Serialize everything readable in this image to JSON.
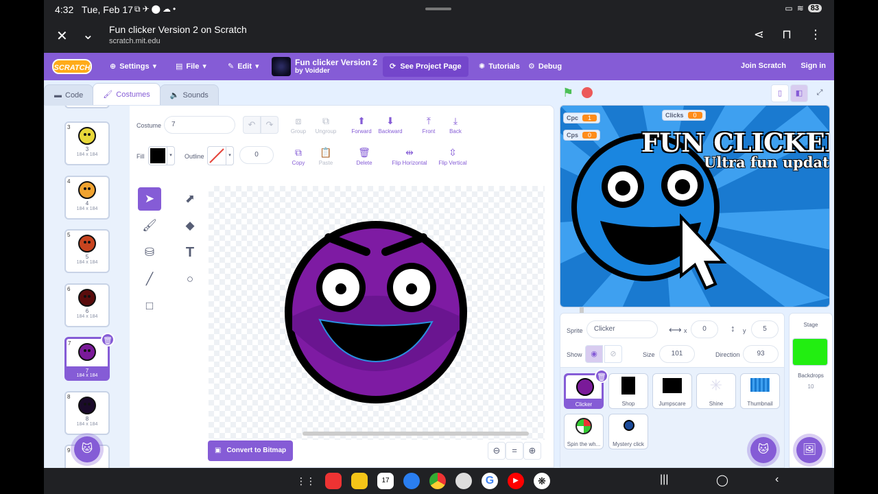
{
  "status": {
    "time": "4:32",
    "date": "Tue, Feb 17",
    "battery": "83"
  },
  "browser": {
    "title": "Fun clicker Version 2 on Scratch",
    "url": "scratch.mit.edu"
  },
  "menu": {
    "logo": "SCRATCH",
    "settings": "Settings",
    "file": "File",
    "edit": "Edit",
    "project_title": "Fun clicker Version 2",
    "project_by": "by Voidder",
    "see_project": "See Project Page",
    "tutorials": "Tutorials",
    "debug": "Debug",
    "join": "Join Scratch",
    "signin": "Sign in"
  },
  "tabs": {
    "code": "Code",
    "costumes": "Costumes",
    "sounds": "Sounds"
  },
  "costumes": [
    {
      "num": "3",
      "name": "3",
      "dims": "184 x 184",
      "color": "#e8d839"
    },
    {
      "num": "4",
      "name": "4",
      "dims": "184 x 184",
      "color": "#f0a330"
    },
    {
      "num": "5",
      "name": "5",
      "dims": "184 x 184",
      "color": "#c8441f"
    },
    {
      "num": "6",
      "name": "6",
      "dims": "184 x 184",
      "color": "#5a0c0c"
    },
    {
      "num": "7",
      "name": "7",
      "dims": "184 x 184",
      "color": "#7a1a99"
    },
    {
      "num": "8",
      "name": "8",
      "dims": "184 x 184",
      "color": "#1a0a2a"
    },
    {
      "num": "9"
    }
  ],
  "paint": {
    "costume_label": "Costume",
    "costume_name": "7",
    "group": "Group",
    "ungroup": "Ungroup",
    "forward": "Forward",
    "backward": "Backward",
    "front": "Front",
    "back": "Back",
    "fill_label": "Fill",
    "outline_label": "Outline",
    "outline_width": "0",
    "copy": "Copy",
    "paste": "Paste",
    "delete": "Delete",
    "flip_h": "Flip Horizontal",
    "flip_v": "Flip Vertical",
    "fill_color": "#000000",
    "convert": "Convert to Bitmap"
  },
  "stage": {
    "monitors": [
      {
        "label": "Clicks",
        "value": "0"
      },
      {
        "label": "Cpc",
        "value": "1"
      },
      {
        "label": "Cps",
        "value": "0"
      }
    ],
    "title": "FUN CLICKER!",
    "subtitle": "Ultra fun updat"
  },
  "sprite_info": {
    "sprite_label": "Sprite",
    "sprite_name": "Clicker",
    "x_label": "x",
    "x": "0",
    "y_label": "y",
    "y": "5",
    "show_label": "Show",
    "size_label": "Size",
    "size": "101",
    "direction_label": "Direction",
    "direction": "93"
  },
  "sprites": [
    "Clicker",
    "Shop",
    "Jumpscare",
    "Shine",
    "Thumbnail",
    "Spin the wh...",
    "Mystery click"
  ],
  "stage_pane": {
    "label": "Stage",
    "backdrops_label": "Backdrops",
    "backdrops_count": "10",
    "backdrop_color": "#22ee11"
  }
}
